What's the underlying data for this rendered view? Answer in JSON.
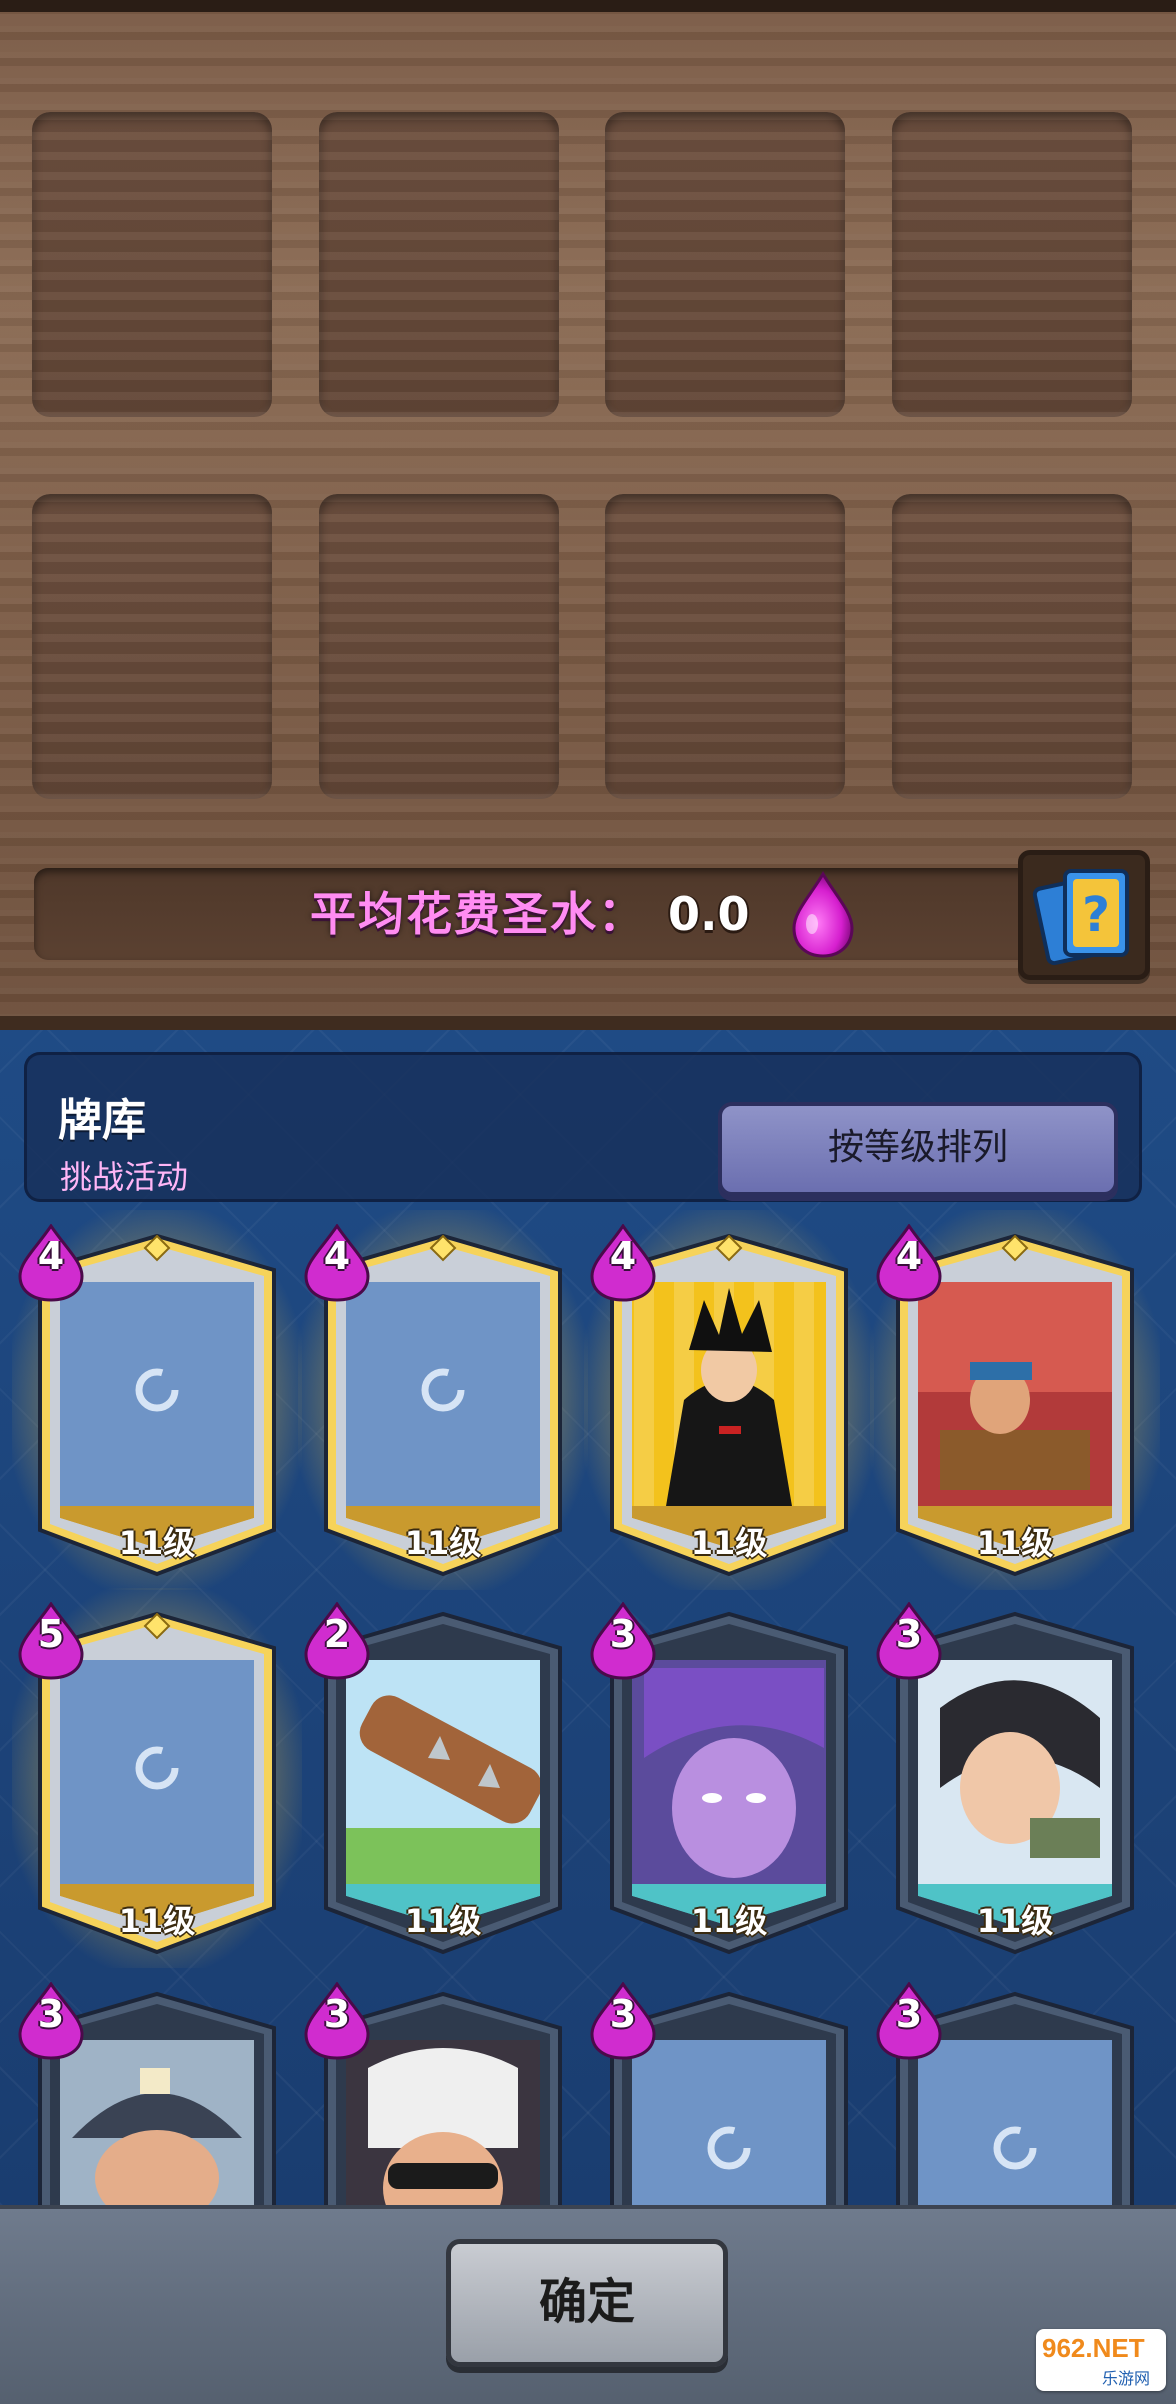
{
  "deck": {
    "slot_count": 8,
    "average_elixir_label": "平均花费圣水：",
    "average_elixir_value": "0.0"
  },
  "collection": {
    "title": "牌库",
    "subtitle": "挑战活动",
    "sort_label": "按等级排列"
  },
  "cards": [
    {
      "cost": "4",
      "level": "11级",
      "featured": true,
      "art": "loading"
    },
    {
      "cost": "4",
      "level": "11级",
      "featured": true,
      "art": "loading"
    },
    {
      "cost": "4",
      "level": "11级",
      "featured": true,
      "art": "goku-hoodie"
    },
    {
      "cost": "4",
      "level": "11级",
      "featured": true,
      "art": "battle-ram"
    },
    {
      "cost": "5",
      "level": "11级",
      "featured": true,
      "art": "loading"
    },
    {
      "cost": "2",
      "level": "11级",
      "featured": false,
      "art": "spiked-log"
    },
    {
      "cost": "3",
      "level": "11级",
      "featured": false,
      "art": "purple-hair-character"
    },
    {
      "cost": "3",
      "level": "11级",
      "featured": false,
      "art": "princess-archer"
    },
    {
      "cost": "3",
      "level": "",
      "featured": false,
      "art": "miner-helmet"
    },
    {
      "cost": "3",
      "level": "",
      "featured": false,
      "art": "bandit-mask"
    },
    {
      "cost": "3",
      "level": "",
      "featured": false,
      "art": "loading"
    },
    {
      "cost": "3",
      "level": "",
      "featured": false,
      "art": "loading"
    }
  ],
  "footer": {
    "confirm_label": "确定"
  },
  "watermark": {
    "brand": "962.NET",
    "sub": "乐游网"
  },
  "colors": {
    "elixir_pink": "#ff8cf2",
    "wood": "#7a5a45",
    "panel_blue": "#1f4b85",
    "card_gold": "#c99a2e",
    "card_teal": "#4fc3c7"
  }
}
